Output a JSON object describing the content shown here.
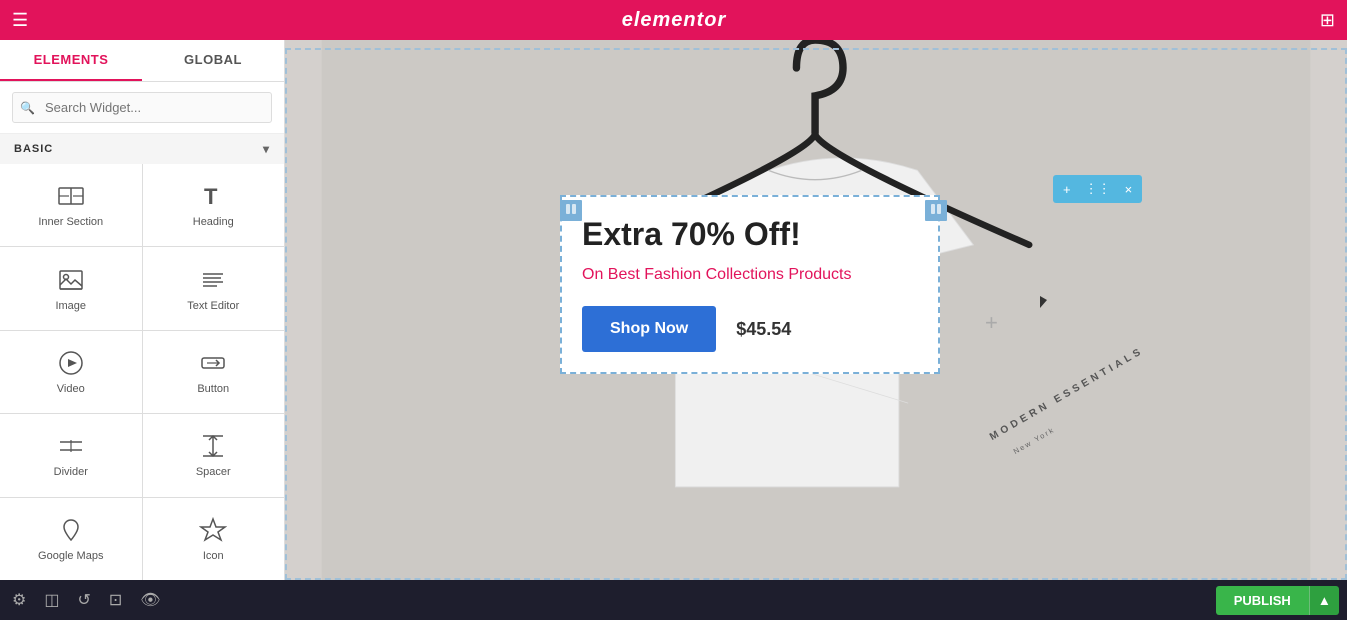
{
  "topbar": {
    "logo": "elementor",
    "hamburger_icon": "☰",
    "grid_icon": "⊞"
  },
  "sidebar": {
    "tabs": [
      {
        "id": "elements",
        "label": "ELEMENTS",
        "active": true
      },
      {
        "id": "global",
        "label": "GLOBAL",
        "active": false
      }
    ],
    "search": {
      "placeholder": "Search Widget..."
    },
    "section_label": "BASIC",
    "widgets": [
      {
        "id": "inner-section",
        "label": "Inner Section",
        "icon": "inner-section"
      },
      {
        "id": "heading",
        "label": "Heading",
        "icon": "heading"
      },
      {
        "id": "image",
        "label": "Image",
        "icon": "image"
      },
      {
        "id": "text-editor",
        "label": "Text Editor",
        "icon": "text-editor"
      },
      {
        "id": "video",
        "label": "Video",
        "icon": "video"
      },
      {
        "id": "button",
        "label": "Button",
        "icon": "button"
      },
      {
        "id": "divider",
        "label": "Divider",
        "icon": "divider"
      },
      {
        "id": "spacer",
        "label": "Spacer",
        "icon": "spacer"
      },
      {
        "id": "google-maps",
        "label": "Google Maps",
        "icon": "map"
      },
      {
        "id": "icon",
        "label": "Icon",
        "icon": "star"
      }
    ]
  },
  "canvas": {
    "heading": "Extra 70% Off!",
    "subtext": "On Best Fashion Collections Products",
    "shop_now": "Shop Now",
    "price": "$45.54",
    "tshirt_brand": "MODERN ESSENTIALS",
    "tshirt_city": "New York"
  },
  "toolbar": {
    "add_icon": "+",
    "move_icon": "⋮⋮",
    "close_icon": "×"
  },
  "bottombar": {
    "settings_icon": "⚙",
    "layers_icon": "◫",
    "history_icon": "↺",
    "responsive_icon": "⊡",
    "preview_icon": "👁",
    "publish_label": "PUBLISH",
    "arrow_icon": "▲"
  }
}
